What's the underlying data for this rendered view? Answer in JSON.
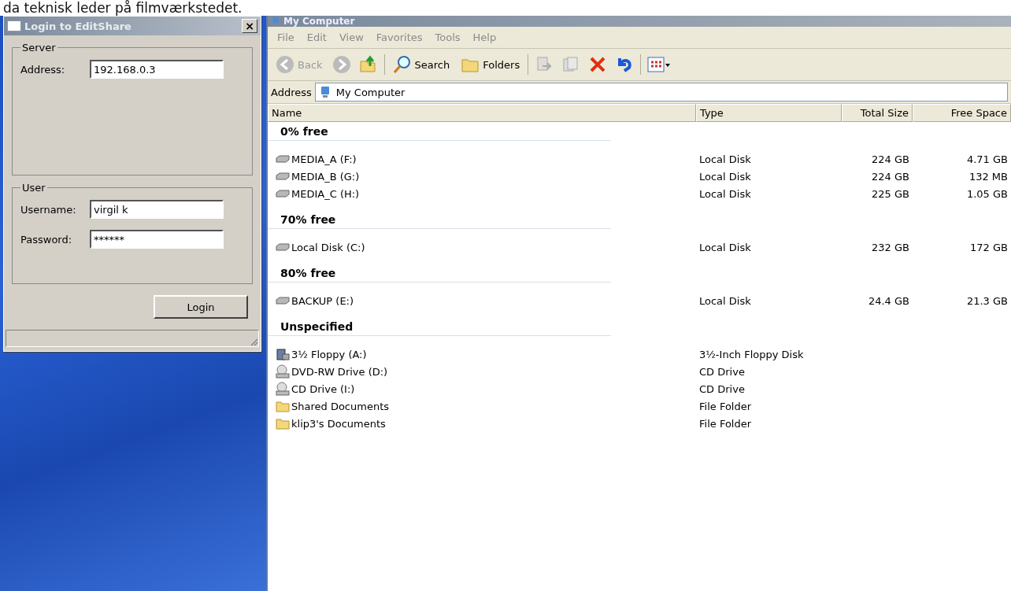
{
  "caption": "da teknisk leder på filmværkstedet.",
  "login_dialog": {
    "title": "Login to EditShare",
    "close": "×",
    "server_group": {
      "legend": "Server",
      "address_label": "Address:",
      "address_value": "192.168.0.3"
    },
    "user_group": {
      "legend": "User",
      "username_label": "Username:",
      "username_value": "virgil k",
      "password_label": "Password:",
      "password_value": "******"
    },
    "login_button": "Login"
  },
  "explorer": {
    "title": "My Computer",
    "menu": [
      "File",
      "Edit",
      "View",
      "Favorites",
      "Tools",
      "Help"
    ],
    "toolbar": {
      "back_label": "Back",
      "search_label": "Search",
      "folders_label": "Folders"
    },
    "address_bar": {
      "label": "Address",
      "value": "My Computer"
    },
    "columns": [
      "Name",
      "Type",
      "Total Size",
      "Free Space"
    ],
    "groups": [
      {
        "title": "0% free",
        "items": [
          {
            "kind": "disk",
            "name": "MEDIA_A (F:)",
            "type": "Local Disk",
            "total_size": "224 GB",
            "free_space": "4.71 GB"
          },
          {
            "kind": "disk",
            "name": "MEDIA_B (G:)",
            "type": "Local Disk",
            "total_size": "224 GB",
            "free_space": "132 MB"
          },
          {
            "kind": "disk",
            "name": "MEDIA_C (H:)",
            "type": "Local Disk",
            "total_size": "225 GB",
            "free_space": "1.05 GB"
          }
        ]
      },
      {
        "title": "70% free",
        "items": [
          {
            "kind": "disk",
            "name": "Local Disk (C:)",
            "type": "Local Disk",
            "total_size": "232 GB",
            "free_space": "172 GB"
          }
        ]
      },
      {
        "title": "80% free",
        "items": [
          {
            "kind": "disk",
            "name": "BACKUP (E:)",
            "type": "Local Disk",
            "total_size": "24.4 GB",
            "free_space": "21.3 GB"
          }
        ]
      },
      {
        "title": "Unspecified",
        "items": [
          {
            "kind": "floppy",
            "name": "3½ Floppy (A:)",
            "type": "3½-Inch Floppy Disk"
          },
          {
            "kind": "cd",
            "name": "DVD-RW Drive (D:)",
            "type": "CD Drive"
          },
          {
            "kind": "cd",
            "name": "CD Drive (I:)",
            "type": "CD Drive"
          },
          {
            "kind": "folder",
            "name": "Shared Documents",
            "type": "File Folder"
          },
          {
            "kind": "folder",
            "name": "klip3's Documents",
            "type": "File Folder"
          }
        ]
      }
    ]
  }
}
